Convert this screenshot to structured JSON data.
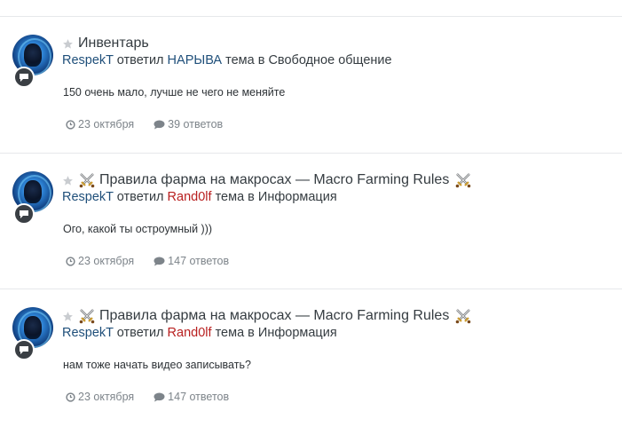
{
  "entries": [
    {
      "title": "Инвентарь",
      "has_swords": false,
      "user": "RespekT",
      "verb": "ответил",
      "topic_user": "НАРЫВА",
      "topic_user_color": "blue",
      "in_text": "тема в",
      "forum": "Свободное общение",
      "snippet": "150 очень мало, лучше не чего не меняйте",
      "date": "23 октября",
      "replies": "39 ответов"
    },
    {
      "title": "Правила фарма на макросах — Macro Farming Rules",
      "has_swords": true,
      "user": "RespekT",
      "verb": "ответил",
      "topic_user": "Rand0lf",
      "topic_user_color": "red",
      "in_text": "тема в",
      "forum": "Информация",
      "snippet": "Ого, какой ты остроумный )))",
      "date": "23 октября",
      "replies": "147 ответов"
    },
    {
      "title": "Правила фарма на макросах — Macro Farming Rules",
      "has_swords": true,
      "user": "RespekT",
      "verb": "ответил",
      "topic_user": "Rand0lf",
      "topic_user_color": "red",
      "in_text": "тема в",
      "forum": "Информация",
      "snippet": "нам тоже начать видео записывать?",
      "date": "23 октября",
      "replies": "147 ответов"
    }
  ],
  "icons": {
    "star": "star-icon",
    "swords": "crossed-swords-icon",
    "clock": "clock-icon",
    "comment": "comment-icon",
    "badge": "speech-bubble-icon"
  },
  "colors": {
    "user_link": "#1f4f7a",
    "red_user": "#b81f1f",
    "meta_gray": "#7d848a",
    "star_gray": "#c9ccd0"
  }
}
